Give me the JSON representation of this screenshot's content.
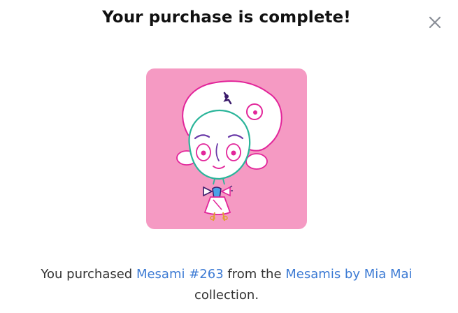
{
  "modal": {
    "title": "Your purchase is complete!",
    "close_icon": "close-icon"
  },
  "artwork": {
    "icon": "nft-artwork-drawing",
    "background_color": "#f59ac3"
  },
  "message": {
    "prefix": "You purchased ",
    "item_link": "Mesami #263",
    "middle": " from the ",
    "collection_link": "Mesamis by Mia Mai",
    "line2": "collection."
  },
  "colors": {
    "link": "#3d7bd4",
    "title": "#111111",
    "close_icon": "#8a8f98"
  }
}
